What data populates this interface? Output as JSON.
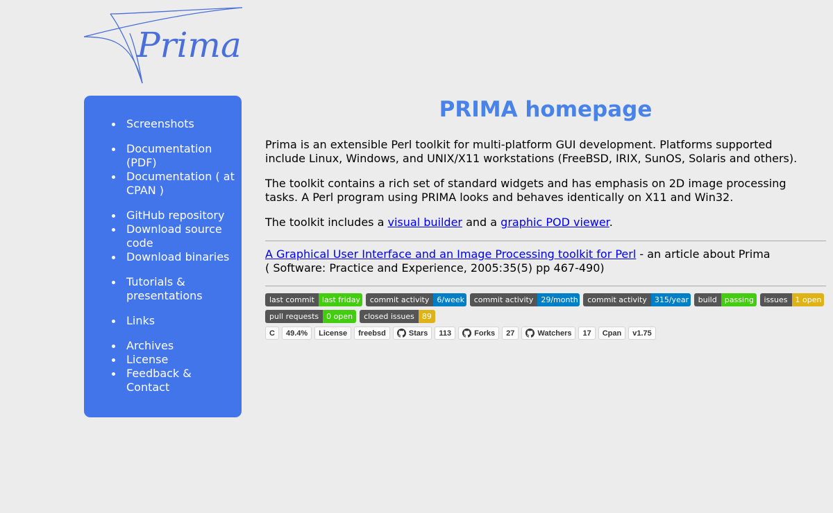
{
  "logo": {
    "text": "Prima",
    "color": "#4a6fd8"
  },
  "sidebar": {
    "background": "#4274ea",
    "items": [
      {
        "label": "Screenshots"
      },
      {
        "label": "Documentation (PDF)"
      },
      {
        "label": "Documentation ( at CPAN )"
      },
      {
        "label": "GitHub repository"
      },
      {
        "label": "Download source code"
      },
      {
        "label": "Download binaries"
      },
      {
        "label": "Tutorials & presentations"
      },
      {
        "label": "Links"
      },
      {
        "label": "Archives"
      },
      {
        "label": "License"
      },
      {
        "label": "Feedback & Contact"
      }
    ]
  },
  "main": {
    "title": "PRIMA homepage",
    "title_color": "#4983e8",
    "intro": "Prima is an extensible Perl toolkit for multi-platform GUI development. Platforms supported include Linux, Windows, and UNIX/X11 workstations (FreeBSD, IRIX, SunOS, Solaris and others).",
    "toolkit_desc": "The toolkit contains a rich set of standard widgets and has emphasis on 2D image processing tasks. A Perl program using PRIMA looks and behaves identically on X11 and Win32.",
    "includes_prefix": "The toolkit includes a ",
    "includes_link1": "visual builder",
    "includes_mid": " and a ",
    "includes_link2": "graphic POD viewer",
    "includes_suffix": ".",
    "article_link": "A Graphical User Interface and an Image Processing toolkit for Perl",
    "article_suffix": " - an article about Prima",
    "article_citation": "( Software: Practice and Experience, 2005:35(5) pp 467-490)"
  },
  "badges": {
    "row1": [
      {
        "label": "last commit",
        "value": "last friday",
        "color": "#4c1"
      },
      {
        "label": "commit activity",
        "value": "6/week",
        "color": "#007ec6"
      },
      {
        "label": "commit activity",
        "value": "29/month",
        "color": "#007ec6"
      },
      {
        "label": "commit activity",
        "value": "315/year",
        "color": "#007ec6"
      },
      {
        "label": "build",
        "value": "passing",
        "color": "#4c1"
      },
      {
        "label": "issues",
        "value": "1 open",
        "color": "#dfb317"
      }
    ],
    "row2": [
      {
        "label": "pull requests",
        "value": "0 open",
        "color": "#4c1"
      },
      {
        "label": "closed issues",
        "value": "89",
        "color": "#dfb317"
      }
    ],
    "row3": {
      "lang": "C",
      "lang_pct": "49.4%",
      "license_label": "License",
      "license_value": "freebsd",
      "stars_label": "Stars",
      "stars_count": "113",
      "forks_label": "Forks",
      "forks_count": "27",
      "watchers_label": "Watchers",
      "watchers_count": "17",
      "cpan_label": "Cpan",
      "cpan_version": "v1.75"
    }
  }
}
